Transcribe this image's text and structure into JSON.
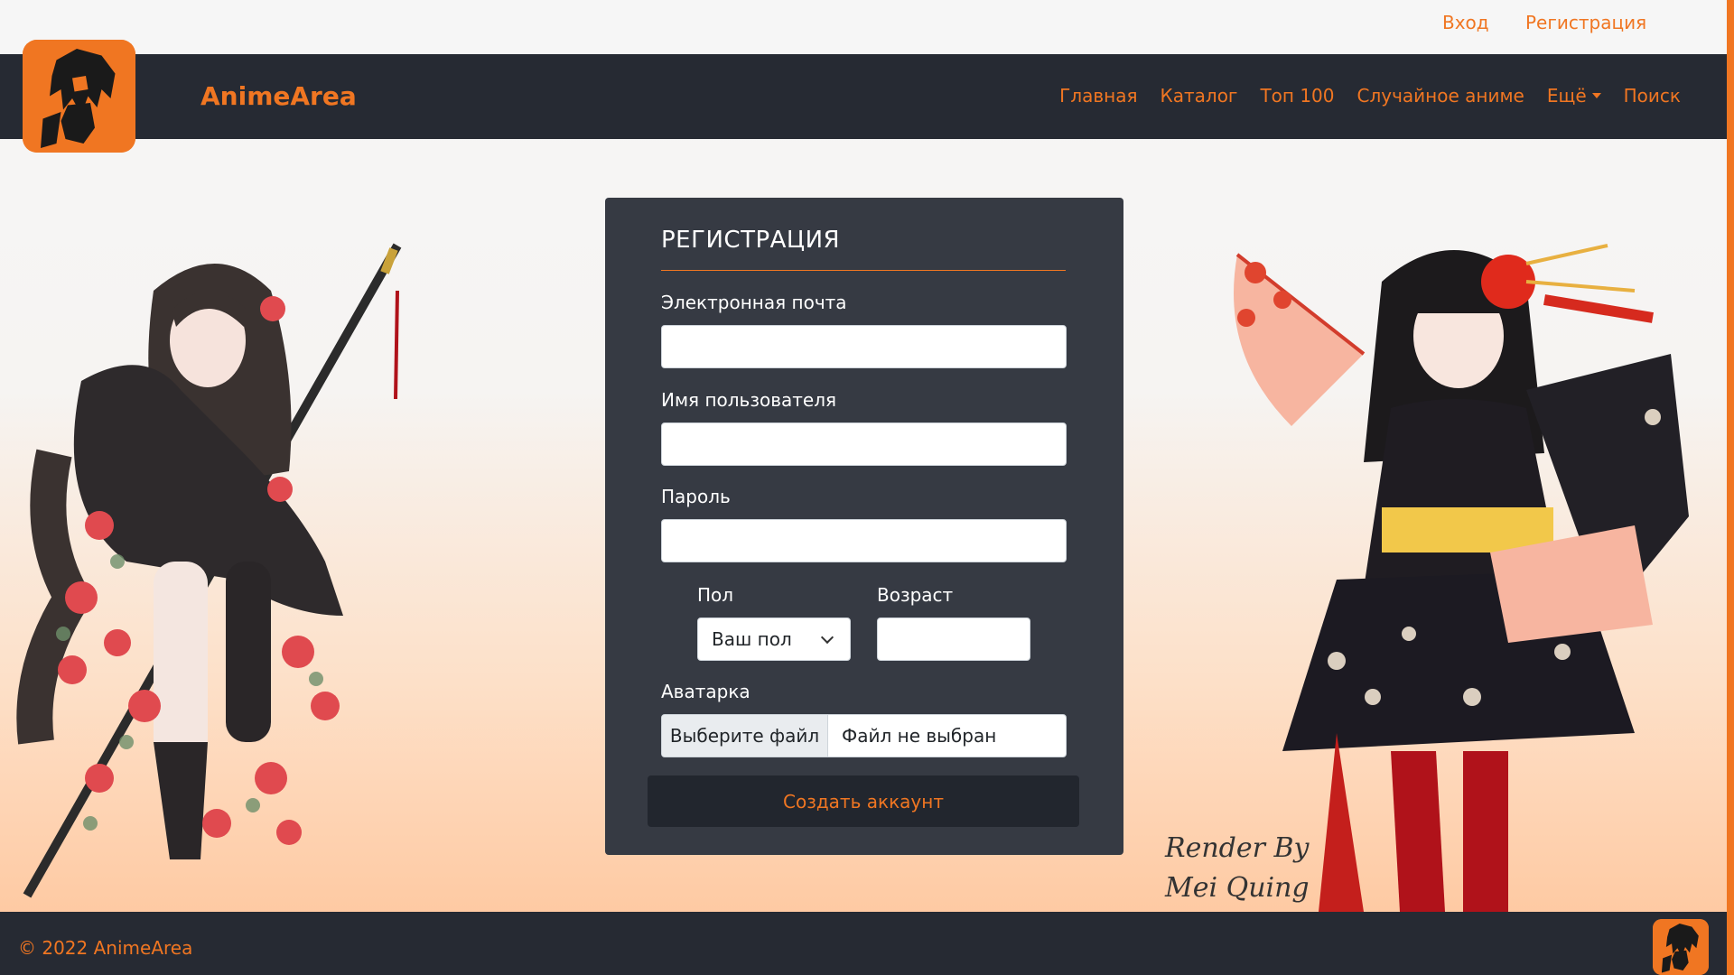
{
  "auth": {
    "login": "Вход",
    "register": "Регистрация"
  },
  "brand": {
    "name": "AnimeArea",
    "logo_icon": "anime-character-logo-icon",
    "accent_color": "#f07622",
    "dark_color": "#262a33"
  },
  "nav": {
    "items": [
      {
        "label": "Главная"
      },
      {
        "label": "Каталог"
      },
      {
        "label": "Топ 100"
      },
      {
        "label": "Случайное аниме"
      },
      {
        "label": "Ещё"
      },
      {
        "label": "Поиск"
      }
    ]
  },
  "form": {
    "title": "РЕГИСТРАЦИЯ",
    "email_label": "Электронная почта",
    "email_value": "",
    "username_label": "Имя пользователя",
    "username_value": "",
    "password_label": "Пароль",
    "password_value": "",
    "gender_label": "Пол",
    "gender_selected": "Ваш пол",
    "age_label": "Возраст",
    "age_value": "",
    "avatar_label": "Аватарка",
    "file_button": "Выберите файл",
    "file_status": "Файл не выбран",
    "submit": "Создать аккаунт"
  },
  "art": {
    "signature_line1": "Render By",
    "signature_line2": "Mei Quing"
  },
  "footer": {
    "copyright": "© 2022 AnimeArea"
  }
}
